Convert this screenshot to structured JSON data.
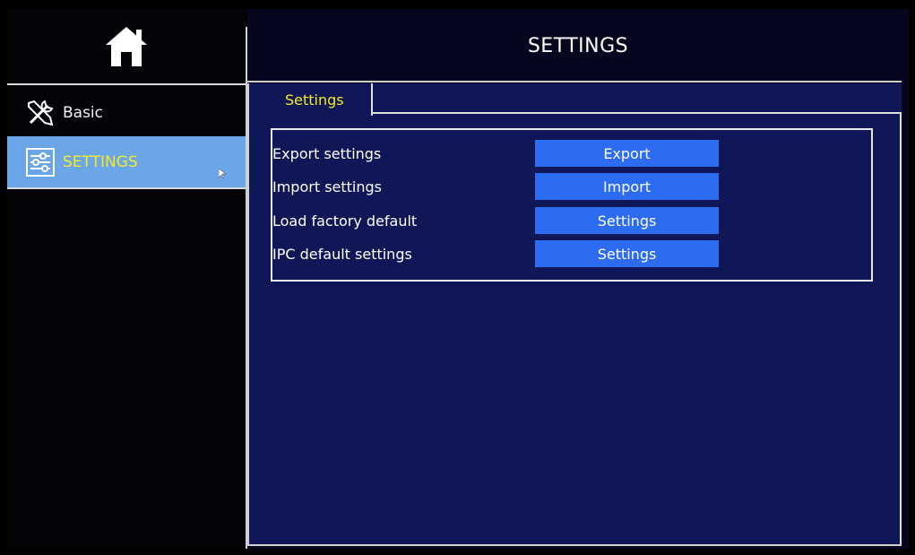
{
  "sidebar": {
    "home_icon": "home-icon",
    "items": [
      {
        "label": "Basic",
        "icon": "tools-icon",
        "selected": false
      },
      {
        "label": "SETTINGS",
        "icon": "sliders-icon",
        "selected": true
      }
    ]
  },
  "header": {
    "title": "SETTINGS"
  },
  "tabs": [
    {
      "label": "Settings",
      "active": true
    }
  ],
  "settings_rows": [
    {
      "label": "Export settings",
      "button": "Export"
    },
    {
      "label": "Import settings",
      "button": "Import"
    },
    {
      "label": "Load factory default",
      "button": "Settings"
    },
    {
      "label": "IPC default settings",
      "button": "Settings"
    }
  ],
  "colors": {
    "accent_yellow": "#f5e92a",
    "selected_bg": "#6ba6e8",
    "button_blue": "#2d6cf0",
    "content_bg": "#0f1756"
  }
}
